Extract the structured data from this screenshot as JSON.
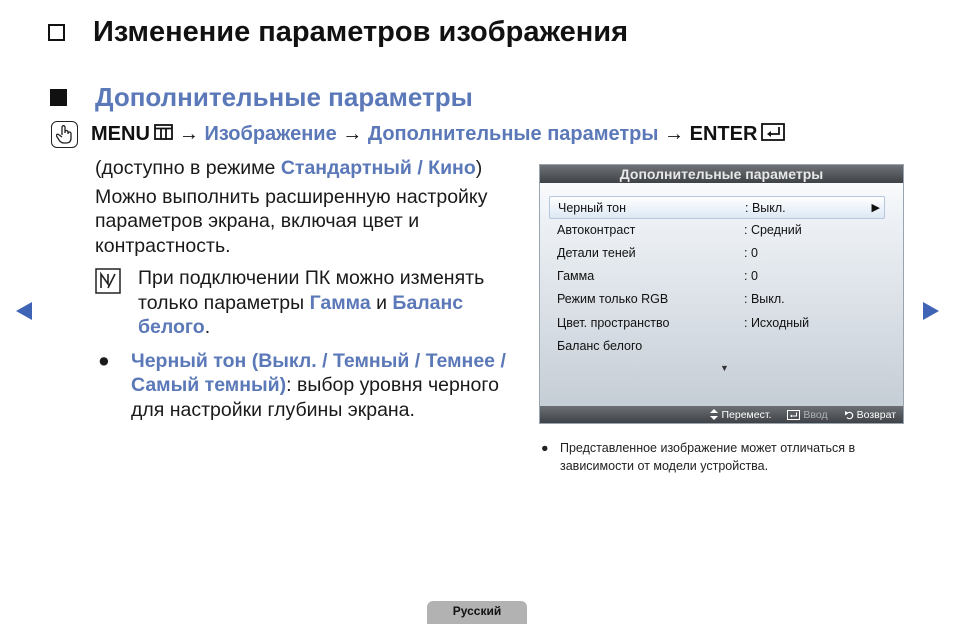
{
  "header": {
    "title": "Изменение параметров изображения"
  },
  "section": {
    "title": "Дополнительные параметры"
  },
  "path": {
    "menu": "MENU",
    "arrow1": "→",
    "step1": "Изображение",
    "arrow2": "→",
    "step2": "Дополнительные параметры",
    "arrow3": "→",
    "enter": "ENTER"
  },
  "body": {
    "avail_prefix": "(доступно в режиме ",
    "avail_modes": "Стандартный / Кино",
    "avail_suffix": ")",
    "description": "Можно выполнить расширенную настройку параметров экрана, включая цвет и контрастность.",
    "note_prefix": "При подключении ПК можно изменять только параметры ",
    "note_gamma": "Гамма",
    "note_and": " и ",
    "note_wb": "Баланс белого",
    "note_end": ".",
    "bullet_symbol": "●",
    "bullet_title": "Черный тон (Выкл. / Темный / Темнее / Самый темный)",
    "bullet_text": ": выбор уровня черного для настройки глубины экрана."
  },
  "tv_menu": {
    "title": "Дополнительные параметры",
    "rows": [
      {
        "label": "Черный тон",
        "value": ": Выкл."
      },
      {
        "label": "Автоконтраст",
        "value": ": Средний"
      },
      {
        "label": "Детали теней",
        "value": ": 0"
      },
      {
        "label": "Гамма",
        "value": ": 0"
      },
      {
        "label": "Режим только RGB",
        "value": ": Выкл."
      },
      {
        "label": "Цвет. пространство",
        "value": ": Исходный"
      },
      {
        "label": "Баланс белого",
        "value": ""
      }
    ],
    "selected_arrow": "▶",
    "more_indicator": "▼",
    "footer": {
      "move": "Перемест.",
      "enter": "Ввод",
      "return": "Возврат"
    }
  },
  "footnote": {
    "bullet": "●",
    "text": "Представленное изображение может отличаться в зависимости от модели устройства."
  },
  "footer": {
    "language": "Русский"
  },
  "colors": {
    "accent": "#5b78b8",
    "nav_arrow": "#3f63b5",
    "tab": "#b2b2b2"
  },
  "icons": [
    "hollow-square-icon",
    "solid-square-icon",
    "remote-hand-icon",
    "menu-grid-icon",
    "enter-icon",
    "note-icon",
    "prev-arrow-icon",
    "next-arrow-icon",
    "updown-icon",
    "return-icon"
  ]
}
